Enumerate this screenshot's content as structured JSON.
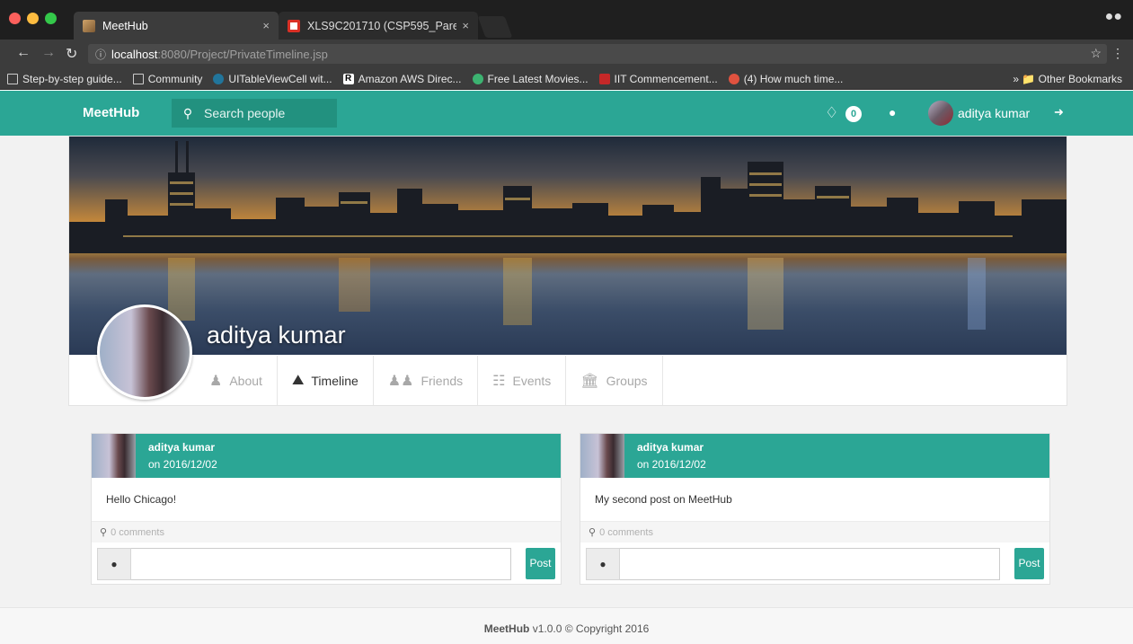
{
  "browser": {
    "tabs": [
      {
        "title": "MeetHub",
        "active": true
      },
      {
        "title": "XLS9C201710 (CSP595_Pare",
        "active": false
      }
    ],
    "close_glyph": "×",
    "url_host": "localhost",
    "url_path": ":8080/Project/PrivateTimeline.jsp",
    "bookmarks": [
      {
        "label": "Step-by-step guide...",
        "icon": "page-icon"
      },
      {
        "label": "Community",
        "icon": "page-icon"
      },
      {
        "label": "UITableViewCell wit...",
        "icon": "wordpress-icon"
      },
      {
        "label": "Amazon AWS Direc...",
        "icon": "r-icon"
      },
      {
        "label": "Free Latest Movies...",
        "icon": "play-icon"
      },
      {
        "label": "IIT Commencement...",
        "icon": "iit-icon"
      },
      {
        "label": "(4) How much time...",
        "icon": "quora-icon"
      }
    ],
    "other_bookmarks": "Other Bookmarks"
  },
  "navbar": {
    "brand": "MeetHub",
    "search_placeholder": "Search people",
    "notification_count": "0",
    "user_name": "aditya kumar"
  },
  "profile": {
    "name": "aditya kumar",
    "tabs": [
      {
        "label": "About",
        "icon": "user-icon",
        "active": false
      },
      {
        "label": "Timeline",
        "icon": "timeline-icon",
        "active": true
      },
      {
        "label": "Friends",
        "icon": "friends-icon",
        "active": false
      },
      {
        "label": "Events",
        "icon": "events-icon",
        "active": false
      },
      {
        "label": "Groups",
        "icon": "groups-icon",
        "active": false
      }
    ]
  },
  "posts": [
    {
      "author": "aditya kumar",
      "date": "on 2016/12/02",
      "text": "Hello Chicago!",
      "comments": "0 comments",
      "post_label": "Post"
    },
    {
      "author": "aditya kumar",
      "date": "on 2016/12/02",
      "text": "My second post on MeetHub",
      "comments": "0 comments",
      "post_label": "Post"
    }
  ],
  "footer": {
    "brand": "MeetHub",
    "text": " v1.0.0 © Copyright 2016"
  },
  "colors": {
    "accent": "#2ba695",
    "accent_dark": "#22917f"
  }
}
